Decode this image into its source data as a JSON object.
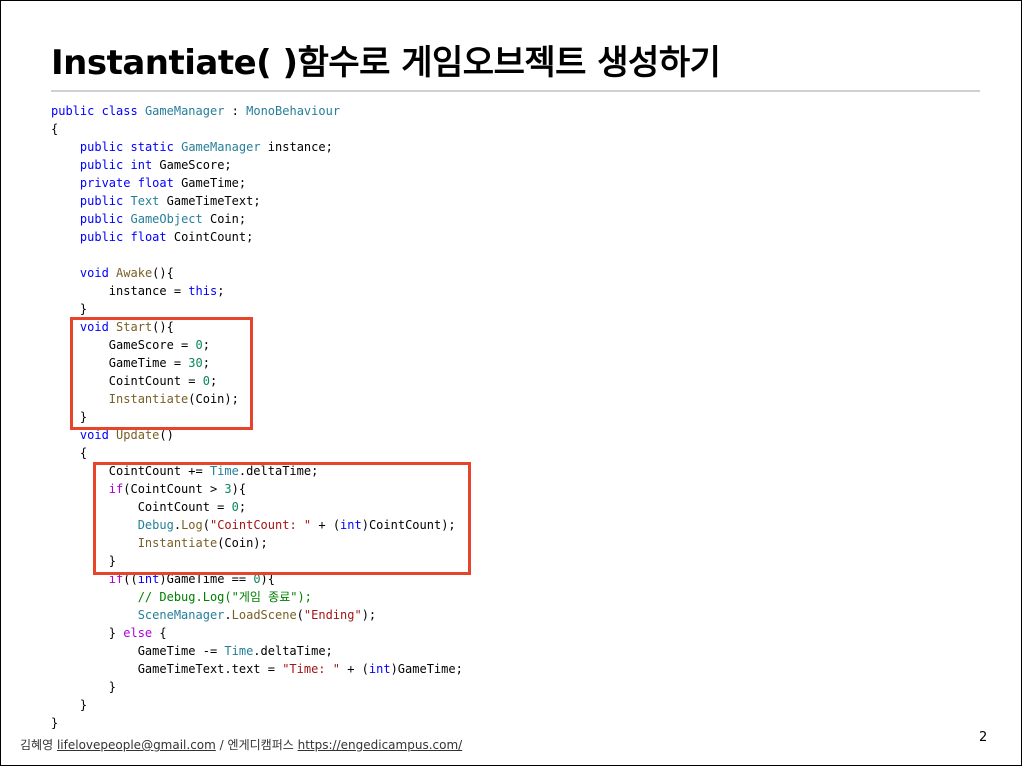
{
  "slide": {
    "title": "Instantiate( )함수로 게임오브젝트 생성하기",
    "page_number": "2"
  },
  "footer": {
    "author": "김혜영",
    "email": "lifelovepeople@gmail.com",
    "separator": "/",
    "org": "엔게디캠퍼스",
    "url": "https://engedicampus.com/"
  },
  "colors": {
    "highlight_box": "#e8442a",
    "keyword": "#0000ff",
    "type": "#267f99",
    "number": "#098658",
    "string": "#a31515",
    "comment": "#008000",
    "method": "#795e26",
    "control": "#af00db"
  },
  "code_lines": [
    [
      {
        "t": "public",
        "c": "kw"
      },
      {
        "t": " "
      },
      {
        "t": "class",
        "c": "kw"
      },
      {
        "t": " "
      },
      {
        "t": "GameManager",
        "c": "type"
      },
      {
        "t": " : "
      },
      {
        "t": "MonoBehaviour",
        "c": "type"
      }
    ],
    [
      {
        "t": "{"
      }
    ],
    [
      {
        "t": "    "
      },
      {
        "t": "public",
        "c": "kw"
      },
      {
        "t": " "
      },
      {
        "t": "static",
        "c": "kw"
      },
      {
        "t": " "
      },
      {
        "t": "GameManager",
        "c": "type"
      },
      {
        "t": " instance;"
      }
    ],
    [
      {
        "t": "    "
      },
      {
        "t": "public",
        "c": "kw"
      },
      {
        "t": " "
      },
      {
        "t": "int",
        "c": "kw"
      },
      {
        "t": " GameScore;"
      }
    ],
    [
      {
        "t": "    "
      },
      {
        "t": "private",
        "c": "kw"
      },
      {
        "t": " "
      },
      {
        "t": "float",
        "c": "kw"
      },
      {
        "t": " GameTime;"
      }
    ],
    [
      {
        "t": "    "
      },
      {
        "t": "public",
        "c": "kw"
      },
      {
        "t": " "
      },
      {
        "t": "Text",
        "c": "type"
      },
      {
        "t": " GameTimeText;"
      }
    ],
    [
      {
        "t": "    "
      },
      {
        "t": "public",
        "c": "kw"
      },
      {
        "t": " "
      },
      {
        "t": "GameObject",
        "c": "type"
      },
      {
        "t": " Coin;"
      }
    ],
    [
      {
        "t": "    "
      },
      {
        "t": "public",
        "c": "kw"
      },
      {
        "t": " "
      },
      {
        "t": "float",
        "c": "kw"
      },
      {
        "t": " CointCount;"
      }
    ],
    [
      {
        "t": ""
      }
    ],
    [
      {
        "t": "    "
      },
      {
        "t": "void",
        "c": "kw"
      },
      {
        "t": " "
      },
      {
        "t": "Awake",
        "c": "fn"
      },
      {
        "t": "(){"
      }
    ],
    [
      {
        "t": "        instance = "
      },
      {
        "t": "this",
        "c": "kw"
      },
      {
        "t": ";"
      }
    ],
    [
      {
        "t": "    }"
      }
    ],
    [
      {
        "t": "    "
      },
      {
        "t": "void",
        "c": "kw"
      },
      {
        "t": " "
      },
      {
        "t": "Start",
        "c": "fn"
      },
      {
        "t": "(){"
      }
    ],
    [
      {
        "t": "        GameScore = "
      },
      {
        "t": "0",
        "c": "num"
      },
      {
        "t": ";"
      }
    ],
    [
      {
        "t": "        GameTime = "
      },
      {
        "t": "30",
        "c": "num"
      },
      {
        "t": ";"
      }
    ],
    [
      {
        "t": "        CointCount = "
      },
      {
        "t": "0",
        "c": "num"
      },
      {
        "t": ";"
      }
    ],
    [
      {
        "t": "        "
      },
      {
        "t": "Instantiate",
        "c": "fn"
      },
      {
        "t": "(Coin);"
      }
    ],
    [
      {
        "t": "    }"
      }
    ],
    [
      {
        "t": "    "
      },
      {
        "t": "void",
        "c": "kw"
      },
      {
        "t": " "
      },
      {
        "t": "Update",
        "c": "fn"
      },
      {
        "t": "()"
      }
    ],
    [
      {
        "t": "    {"
      }
    ],
    [
      {
        "t": "        CointCount += "
      },
      {
        "t": "Time",
        "c": "type"
      },
      {
        "t": ".deltaTime;"
      }
    ],
    [
      {
        "t": "        "
      },
      {
        "t": "if",
        "c": "ctl"
      },
      {
        "t": "(CointCount > "
      },
      {
        "t": "3",
        "c": "num"
      },
      {
        "t": "){"
      }
    ],
    [
      {
        "t": "            CointCount = "
      },
      {
        "t": "0",
        "c": "num"
      },
      {
        "t": ";"
      }
    ],
    [
      {
        "t": "            "
      },
      {
        "t": "Debug",
        "c": "type"
      },
      {
        "t": "."
      },
      {
        "t": "Log",
        "c": "fn"
      },
      {
        "t": "("
      },
      {
        "t": "\"CointCount: \"",
        "c": "str"
      },
      {
        "t": " + ("
      },
      {
        "t": "int",
        "c": "kw"
      },
      {
        "t": ")CointCount);"
      }
    ],
    [
      {
        "t": "            "
      },
      {
        "t": "Instantiate",
        "c": "fn"
      },
      {
        "t": "(Coin);"
      }
    ],
    [
      {
        "t": "        }"
      }
    ],
    [
      {
        "t": "        "
      },
      {
        "t": "if",
        "c": "ctl"
      },
      {
        "t": "(("
      },
      {
        "t": "int",
        "c": "kw"
      },
      {
        "t": ")GameTime == "
      },
      {
        "t": "0",
        "c": "num"
      },
      {
        "t": "){"
      }
    ],
    [
      {
        "t": "            "
      },
      {
        "t": "// Debug.Log(\"게임 종료\");",
        "c": "cmt"
      }
    ],
    [
      {
        "t": "            "
      },
      {
        "t": "SceneManager",
        "c": "type"
      },
      {
        "t": "."
      },
      {
        "t": "LoadScene",
        "c": "fn"
      },
      {
        "t": "("
      },
      {
        "t": "\"Ending\"",
        "c": "str"
      },
      {
        "t": ");"
      }
    ],
    [
      {
        "t": "        } "
      },
      {
        "t": "else",
        "c": "ctl"
      },
      {
        "t": " {"
      }
    ],
    [
      {
        "t": "            GameTime -= "
      },
      {
        "t": "Time",
        "c": "type"
      },
      {
        "t": ".deltaTime;"
      }
    ],
    [
      {
        "t": "            GameTimeText.text = "
      },
      {
        "t": "\"Time: \"",
        "c": "str"
      },
      {
        "t": " + ("
      },
      {
        "t": "int",
        "c": "kw"
      },
      {
        "t": ")GameTime;"
      }
    ],
    [
      {
        "t": "        }"
      }
    ],
    [
      {
        "t": "    }"
      }
    ],
    [
      {
        "t": "}"
      }
    ]
  ]
}
